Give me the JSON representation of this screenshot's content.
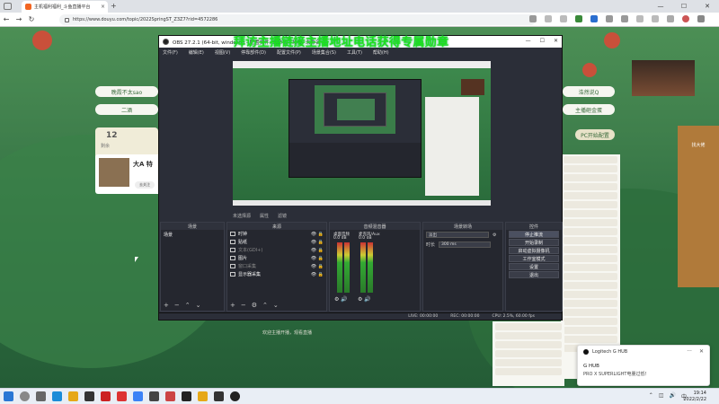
{
  "browser": {
    "tab_title": "主机福利福利_斗鱼直播平台",
    "url": "https://www.douyu.com/topic/2022SpringST_Z3Z7?rid=4572286",
    "new_tab": "+",
    "win": {
      "min": "—",
      "max": "☐",
      "close": "✕"
    }
  },
  "page": {
    "banner": "拜访主播链接主播地址电话获得专属勋章",
    "left_pills": [
      "晚霞不太sao",
      "二酒"
    ],
    "card_number": "12",
    "card_label": "剩余",
    "user_name": "大A 特",
    "user_btn": "去关注",
    "right_pills": [
      "浩然说Q",
      "主播砸金蛋",
      "PC开始配置"
    ],
    "under_obs_text": "欢迎主播开播，观看直播",
    "ad_text": "找大佬"
  },
  "obs": {
    "title": "OBS 27.2.1 (64-bit, windows) - 配置文件: 未命名 - 场景: 未命名",
    "menu": [
      "文件(F)",
      "编辑(E)",
      "视图(V)",
      "停靠部件(D)",
      "配置文件(P)",
      "场景集合(S)",
      "工具(T)",
      "帮助(H)"
    ],
    "win": {
      "min": "—",
      "max": "☐",
      "close": "✕"
    },
    "scene_bar": [
      "未选择源",
      "属性",
      "滤镜"
    ],
    "docks": {
      "scenes": {
        "title": "场景",
        "items": [
          "场景"
        ]
      },
      "sources": {
        "title": "来源",
        "items": [
          {
            "label": "时钟",
            "dim": false
          },
          {
            "label": "贴纸",
            "dim": false
          },
          {
            "label": "文本(GDI+)",
            "dim": true
          },
          {
            "label": "图片",
            "dim": false
          },
          {
            "label": "窗口采集",
            "dim": true
          },
          {
            "label": "显示器采集",
            "dim": false
          }
        ]
      },
      "mixer": {
        "title": "音频混音器",
        "ch1_label": "桌面音频",
        "ch1_db": "0.0 dB",
        "ch2_label": "麦克风/Aux",
        "ch2_db": "0.0 dB"
      },
      "transitions": {
        "title": "场景转场",
        "type": "淡出",
        "duration_label": "时长",
        "duration": "300 ms"
      },
      "controls": {
        "title": "控件",
        "buttons": [
          "停止推流",
          "开始录制",
          "启动虚拟摄像机",
          "工作室模式",
          "设置",
          "退出"
        ]
      }
    },
    "status": {
      "live": "LIVE: 00:00:00",
      "rec": "REC: 00:00:00",
      "cpu": "CPU: 2.5%, 60.00 fps"
    }
  },
  "toast": {
    "app": "Logitech G HUB",
    "title": "G HUB",
    "body": "PRO X SUPERLIGHT电量过低！"
  },
  "taskbar": {
    "time": "19:14",
    "date": "2022/2/22",
    "lang": "中"
  },
  "colors": {
    "banner_green": "#1de01d",
    "obs_bg": "#2b2e38",
    "page_green": "#3f7f4c"
  }
}
